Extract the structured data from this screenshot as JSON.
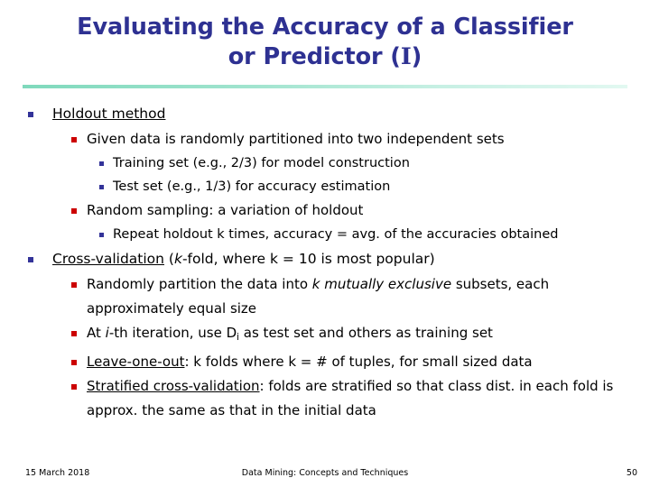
{
  "slide": {
    "title_lines": [
      "Evaluating the Accuracy of a Classifier",
      "or Predictor (I)"
    ],
    "title_color": "#2E3192",
    "divider_color": "#8FDFC4",
    "background_color": "#FFFFFF",
    "bullet_colors": {
      "level1": "#333399",
      "level2": "#CC0000",
      "level3": "#333399"
    },
    "body": [
      {
        "level": 1,
        "text": "Holdout method",
        "underlined_part": "Holdout method"
      },
      {
        "level": 2,
        "text": "Given data is randomly partitioned into two independent sets"
      },
      {
        "level": 3,
        "text": "Training set (e.g., 2/3) for model construction"
      },
      {
        "level": 3,
        "text": "Test set (e.g., 1/3) for accuracy estimation"
      },
      {
        "level": 2,
        "text": "Random sampling: a variation of holdout"
      },
      {
        "level": 3,
        "text": "Repeat holdout k times, accuracy = avg. of the accuracies obtained"
      },
      {
        "level": 1,
        "text": "Cross-validation (k-fold, where k = 10 is most popular)",
        "underlined_part": "Cross-validation",
        "italic_part": "k",
        "rest": "-fold, where k = 10 is most popular)"
      },
      {
        "level": 2,
        "text": "Randomly partition the data into k mutually exclusive subsets, each approximately equal size",
        "italic_part": "k mutually exclusive"
      },
      {
        "level": 2,
        "text": "At i-th iteration, use Di as test set and others as training set",
        "italic_part": "i",
        "subscript": "i"
      },
      {
        "level": 2,
        "text": "Leave-one-out: k folds where k = # of tuples, for small sized data",
        "underlined_part": "Leave-one-out"
      },
      {
        "level": 2,
        "text": "Stratified cross-validation: folds are stratified so that class dist. in each fold is approx. the same as that in the initial data",
        "underlined_part": "Stratified cross-validation"
      }
    ],
    "body_text": {
      "holdout_method": "Holdout method",
      "given_data": "Given data is randomly partitioned into two independent sets",
      "training_set": "Training set (e.g., 2/3) for model construction",
      "test_set": "Test set (e.g., 1/3) for accuracy estimation",
      "random_sampling": "Random sampling: a variation of holdout",
      "repeat_holdout": "Repeat holdout k times, accuracy = avg. of the accuracies obtained",
      "cross_validation_label": "Cross-validation",
      "cross_validation_open": " (",
      "cross_validation_k": "k",
      "cross_validation_rest": "-fold, where k = 10 is most popular)",
      "randomly_partition_pre": "Randomly partition the data into ",
      "randomly_partition_italic": "k mutually exclusive",
      "randomly_partition_post": " subsets, each approximately equal size",
      "at_ith_pre": "At ",
      "at_ith_italic": "i",
      "at_ith_mid": "-th iteration, use D",
      "at_ith_sub": "i",
      "at_ith_post": " as test set and others as training set",
      "leave_one_out_label": "Leave-one-out",
      "leave_one_out_rest": ": k folds where k = # of tuples, for small sized data",
      "stratified_label": "Stratified cross-validation",
      "stratified_rest": ": folds are stratified so that class dist. in each fold is approx. the same as that in the initial data"
    },
    "footer": {
      "date": "15 March 2018",
      "center": "Data Mining: Concepts and Techniques",
      "page": "50"
    }
  }
}
